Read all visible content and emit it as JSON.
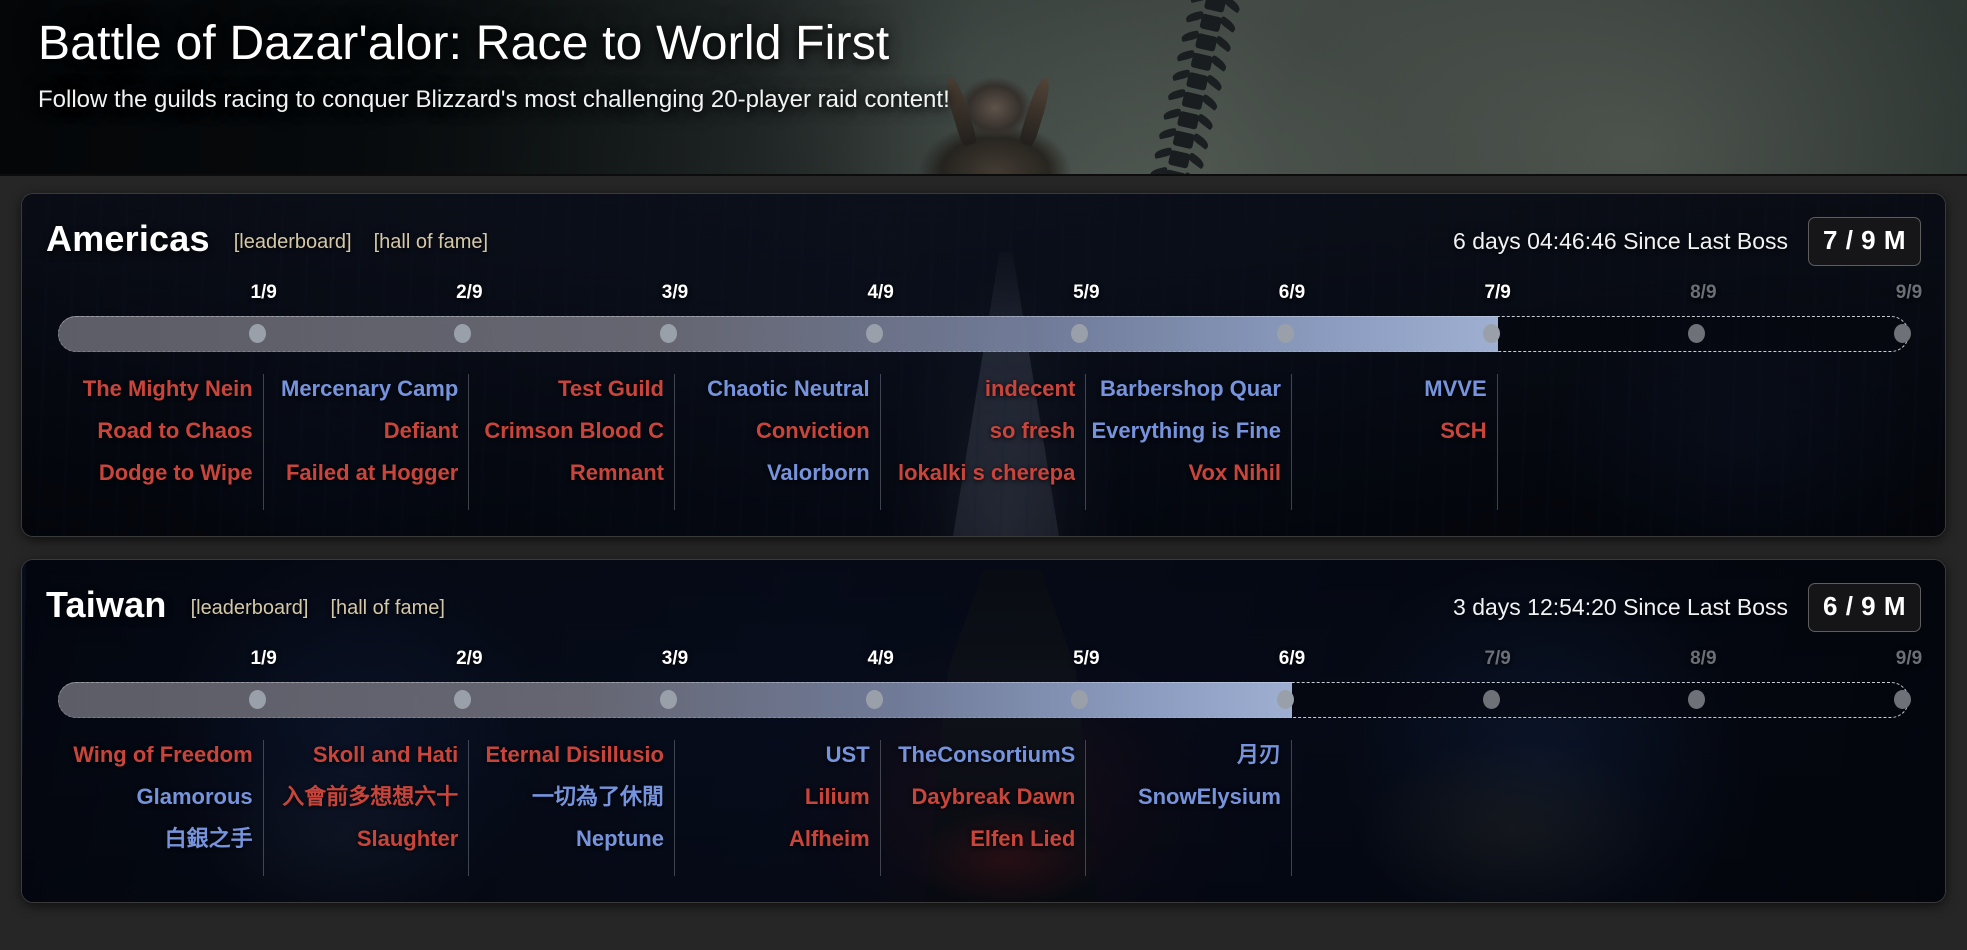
{
  "banner": {
    "title": "Battle of Dazar'alor: Race to World First",
    "subtitle": "Follow the guilds racing to conquer Blizzard's most challenging 20-player raid content!"
  },
  "colors": {
    "horde": "#c9453c",
    "alliance": "#7694dd",
    "link": "#d5c8a8",
    "tick_active": "#ffffff",
    "tick_dim": "#6a6f78",
    "bar_fill_end": "#a6b8dc"
  },
  "regions": [
    {
      "name": "Americas",
      "leaderboard_label": "[leaderboard]",
      "hall_of_fame_label": "[hall of fame]",
      "since_last_boss": "6 days 04:46:46 Since Last Boss",
      "progress_badge": "7 / 9 M",
      "progress_bosses_killed": 7,
      "total_bosses": 9,
      "ticks": [
        {
          "label": "1/9",
          "dim": false
        },
        {
          "label": "2/9",
          "dim": false
        },
        {
          "label": "3/9",
          "dim": false
        },
        {
          "label": "4/9",
          "dim": false
        },
        {
          "label": "5/9",
          "dim": false
        },
        {
          "label": "6/9",
          "dim": false
        },
        {
          "label": "7/9",
          "dim": false
        },
        {
          "label": "8/9",
          "dim": true
        },
        {
          "label": "9/9",
          "dim": true
        }
      ],
      "columns": [
        {
          "boss": "1/9",
          "guilds": [
            {
              "name": "The Mighty Nein",
              "faction": "horde"
            },
            {
              "name": "Road to Chaos",
              "faction": "horde"
            },
            {
              "name": "Dodge to Wipe",
              "faction": "horde"
            }
          ]
        },
        {
          "boss": "2/9",
          "guilds": [
            {
              "name": "Mercenary Camp",
              "faction": "alliance"
            },
            {
              "name": "Defiant",
              "faction": "horde"
            },
            {
              "name": "Failed at Hogger",
              "faction": "horde"
            }
          ]
        },
        {
          "boss": "3/9",
          "guilds": [
            {
              "name": "Test Guild",
              "faction": "horde"
            },
            {
              "name": "Crimson Blood C",
              "faction": "horde"
            },
            {
              "name": "Remnant",
              "faction": "horde"
            }
          ]
        },
        {
          "boss": "4/9",
          "guilds": [
            {
              "name": "Chaotic Neutral",
              "faction": "alliance"
            },
            {
              "name": "Conviction",
              "faction": "horde"
            },
            {
              "name": "Valorborn",
              "faction": "alliance"
            }
          ]
        },
        {
          "boss": "5/9",
          "guilds": [
            {
              "name": "indecent",
              "faction": "horde"
            },
            {
              "name": "so fresh",
              "faction": "horde"
            },
            {
              "name": "lokalki s cherepa",
              "faction": "horde"
            }
          ]
        },
        {
          "boss": "6/9",
          "guilds": [
            {
              "name": "Barbershop Quar",
              "faction": "alliance"
            },
            {
              "name": "Everything is Fine",
              "faction": "alliance"
            },
            {
              "name": "Vox Nihil",
              "faction": "horde"
            }
          ]
        },
        {
          "boss": "7/9",
          "guilds": [
            {
              "name": "MVVE",
              "faction": "alliance"
            },
            {
              "name": "SCH",
              "faction": "horde"
            }
          ]
        }
      ]
    },
    {
      "name": "Taiwan",
      "leaderboard_label": "[leaderboard]",
      "hall_of_fame_label": "[hall of fame]",
      "since_last_boss": "3 days 12:54:20 Since Last Boss",
      "progress_badge": "6 / 9 M",
      "progress_bosses_killed": 6,
      "total_bosses": 9,
      "ticks": [
        {
          "label": "1/9",
          "dim": false
        },
        {
          "label": "2/9",
          "dim": false
        },
        {
          "label": "3/9",
          "dim": false
        },
        {
          "label": "4/9",
          "dim": false
        },
        {
          "label": "5/9",
          "dim": false
        },
        {
          "label": "6/9",
          "dim": false
        },
        {
          "label": "7/9",
          "dim": true
        },
        {
          "label": "8/9",
          "dim": true
        },
        {
          "label": "9/9",
          "dim": true
        }
      ],
      "columns": [
        {
          "boss": "1/9",
          "guilds": [
            {
              "name": "Wing of Freedom",
              "faction": "horde"
            },
            {
              "name": "Glamorous",
              "faction": "alliance"
            },
            {
              "name": "白銀之手",
              "faction": "alliance"
            }
          ]
        },
        {
          "boss": "2/9",
          "guilds": [
            {
              "name": "Skoll and Hati",
              "faction": "horde"
            },
            {
              "name": "入會前多想想六十",
              "faction": "horde"
            },
            {
              "name": "Slaughter",
              "faction": "horde"
            }
          ]
        },
        {
          "boss": "3/9",
          "guilds": [
            {
              "name": "Eternal Disillusio",
              "faction": "horde"
            },
            {
              "name": "一切為了休閒",
              "faction": "alliance"
            },
            {
              "name": "Neptune",
              "faction": "alliance"
            }
          ]
        },
        {
          "boss": "4/9",
          "guilds": [
            {
              "name": "UST",
              "faction": "alliance"
            },
            {
              "name": "Lilium",
              "faction": "horde"
            },
            {
              "name": "Alfheim",
              "faction": "horde"
            }
          ]
        },
        {
          "boss": "5/9",
          "guilds": [
            {
              "name": "TheConsortiumS",
              "faction": "alliance"
            },
            {
              "name": "Daybreak Dawn",
              "faction": "horde"
            },
            {
              "name": "Elfen Lied",
              "faction": "horde"
            }
          ]
        },
        {
          "boss": "6/9",
          "guilds": [
            {
              "name": "月刃",
              "faction": "alliance"
            },
            {
              "name": "SnowElysium",
              "faction": "alliance"
            }
          ]
        }
      ]
    }
  ]
}
